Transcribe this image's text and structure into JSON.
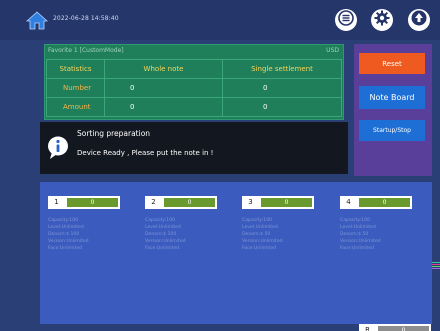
{
  "header": {
    "datetime": "2022-06-28 14:58:40",
    "buttons": {
      "menu": "menu-icon",
      "settings": "gear-icon",
      "upload": "upload-icon"
    }
  },
  "stats": {
    "title": "Favorite 1 [CustomMode]",
    "currency": "USD",
    "columns": [
      "Statistics",
      "Whole note",
      "Single settlement"
    ],
    "rows": [
      {
        "label": "Number",
        "whole": "0",
        "single": "0"
      },
      {
        "label": "Amount",
        "whole": "0",
        "single": "0"
      }
    ]
  },
  "side_buttons": {
    "reset": "Reset",
    "note_board": "Note Board",
    "startup_stop": "Startup/Stop"
  },
  "message": {
    "title": "Sorting preparation",
    "body": "Device Ready , Please put the note in !"
  },
  "pockets": [
    {
      "num": "1",
      "count": "0",
      "lines": [
        "Capacity:100",
        "Level:Unlimited",
        "Denom:$ 100",
        "Version:Unlimited",
        "Face:Unlimited"
      ]
    },
    {
      "num": "2",
      "count": "0",
      "lines": [
        "Capacity:100",
        "Level:Unlimited",
        "Denom:$ 100",
        "Version:Unlimited",
        "Face:Unlimited"
      ]
    },
    {
      "num": "3",
      "count": "0",
      "lines": [
        "Capacity:100",
        "Level:Unlimited",
        "Denom:$ 50",
        "Version:Unlimited",
        "Face:Unlimited"
      ]
    },
    {
      "num": "4",
      "count": "0",
      "lines": [
        "Capacity:100",
        "Level:Unlimited",
        "Denom:$ 50",
        "Version:Unlimited",
        "Face:Unlimited"
      ]
    }
  ],
  "reject": {
    "label": "R",
    "count": "0"
  },
  "colors": {
    "background": "#2b3f77",
    "stats_bg": "#1f7f5a",
    "side_panel": "#5a3f9a",
    "reset": "#ee5a1f",
    "blue_button": "#1d6fd6",
    "pockets_bg": "#3b5bbe",
    "pocket_count": "#6a9a2d"
  }
}
